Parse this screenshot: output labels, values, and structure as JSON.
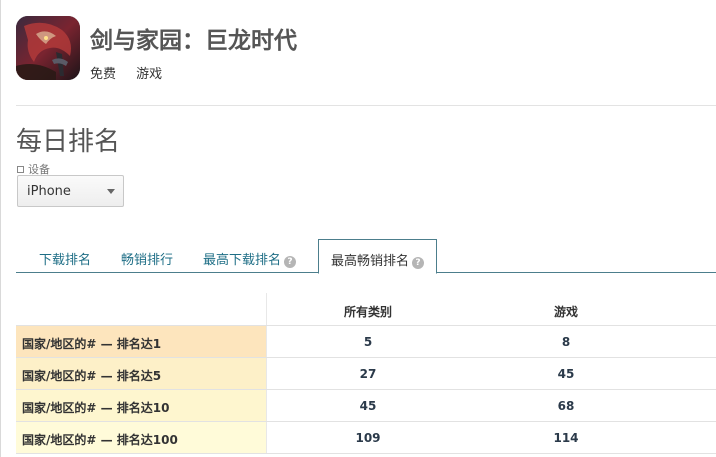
{
  "app": {
    "title": "剑与家园：巨龙时代",
    "price": "免费",
    "category": "游戏"
  },
  "section_title": "每日排名",
  "device": {
    "label": "设备",
    "selected": "iPhone"
  },
  "tabs": [
    {
      "label": "下载排名",
      "active": false,
      "has_help": false
    },
    {
      "label": "畅销排行",
      "active": false,
      "has_help": false
    },
    {
      "label": "最高下载排名",
      "active": false,
      "has_help": true
    },
    {
      "label": "最高畅销排名",
      "active": true,
      "has_help": true
    }
  ],
  "table": {
    "columns": [
      "所有类别",
      "游戏"
    ],
    "rows": [
      {
        "label": "国家/地区的# — 排名达1",
        "all": "5",
        "games": "8",
        "color": "#fde5bd"
      },
      {
        "label": "国家/地区的# — 排名达5",
        "all": "27",
        "games": "45",
        "color": "#fdf0c8"
      },
      {
        "label": "国家/地区的# — 排名达10",
        "all": "45",
        "games": "68",
        "color": "#fef6cf"
      },
      {
        "label": "国家/地区的# — 排名达100",
        "all": "109",
        "games": "114",
        "color": "#fffbd9"
      }
    ]
  },
  "icons": {
    "app_icon": "dragon-app-icon",
    "help": "question-circle-icon",
    "dropdown": "caret-down-icon"
  }
}
